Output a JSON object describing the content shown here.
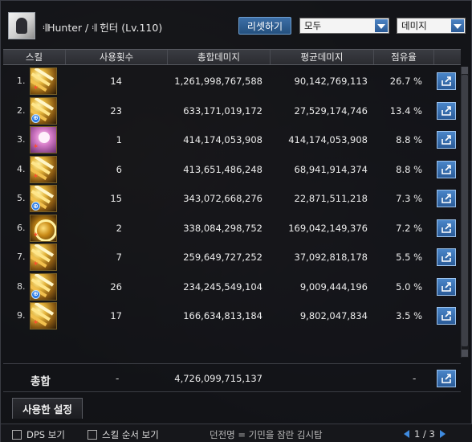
{
  "header": {
    "title": "𝄇Hunter / 𝄇 헌터 (Lv.110)",
    "reset_label": "리셋하기",
    "filter_value": "모두",
    "sort_value": "데미지"
  },
  "columns": [
    "스킬",
    "사용횟수",
    "총합데미지",
    "평균데미지",
    "점유율"
  ],
  "rows": [
    {
      "rank": "1.",
      "uses": "14",
      "total": "1,261,998,767,588",
      "avg": "90,142,769,113",
      "share": "26.7 %",
      "badge": "red",
      "icon": "gold-strike-icon"
    },
    {
      "rank": "2.",
      "uses": "23",
      "total": "633,171,019,172",
      "avg": "27,529,174,746",
      "share": "13.4 %",
      "badge": "blue",
      "icon": "gold-arrow-icon"
    },
    {
      "rank": "3.",
      "uses": "1",
      "total": "414,174,053,908",
      "avg": "414,174,053,908",
      "share": "8.8 %",
      "badge": "red",
      "icon": "pink-character-icon"
    },
    {
      "rank": "4.",
      "uses": "6",
      "total": "413,651,486,248",
      "avg": "68,941,914,374",
      "share": "8.8 %",
      "badge": "red",
      "icon": "gold-burst-icon"
    },
    {
      "rank": "5.",
      "uses": "15",
      "total": "343,072,668,276",
      "avg": "22,871,511,218",
      "share": "7.3 %",
      "badge": "blue",
      "icon": "gold-arrow-icon"
    },
    {
      "rank": "6.",
      "uses": "2",
      "total": "338,084,298,752",
      "avg": "169,042,149,376",
      "share": "7.2 %",
      "badge": "red",
      "icon": "crosshair-icon"
    },
    {
      "rank": "7.",
      "uses": "7",
      "total": "259,649,727,252",
      "avg": "37,092,818,178",
      "share": "5.5 %",
      "badge": "red",
      "icon": "gold-strike-icon"
    },
    {
      "rank": "8.",
      "uses": "26",
      "total": "234,245,549,104",
      "avg": "9,009,444,196",
      "share": "5.0 %",
      "badge": "blue",
      "icon": "gold-arrow-icon"
    },
    {
      "rank": "9.",
      "uses": "17",
      "total": "166,634,813,184",
      "avg": "9,802,047,834",
      "share": "3.5 %",
      "badge": "red",
      "icon": "gold-arrow-icon"
    }
  ],
  "total_row": {
    "label": "총합",
    "uses": "-",
    "total": "4,726,099,715,137",
    "share": "-"
  },
  "tab_label": "사용한 설정",
  "footer": {
    "dps_label": "DPS 보기",
    "order_label": "스킬 순서 보기",
    "caption": "던전명 = 기민을 잠란 김시탑",
    "page": "1 / 3"
  },
  "colors": {
    "accent": "#2c6fb8",
    "panel": "#121317",
    "badge_red": "#ff4d2e",
    "badge_blue": "#2c7be5"
  }
}
